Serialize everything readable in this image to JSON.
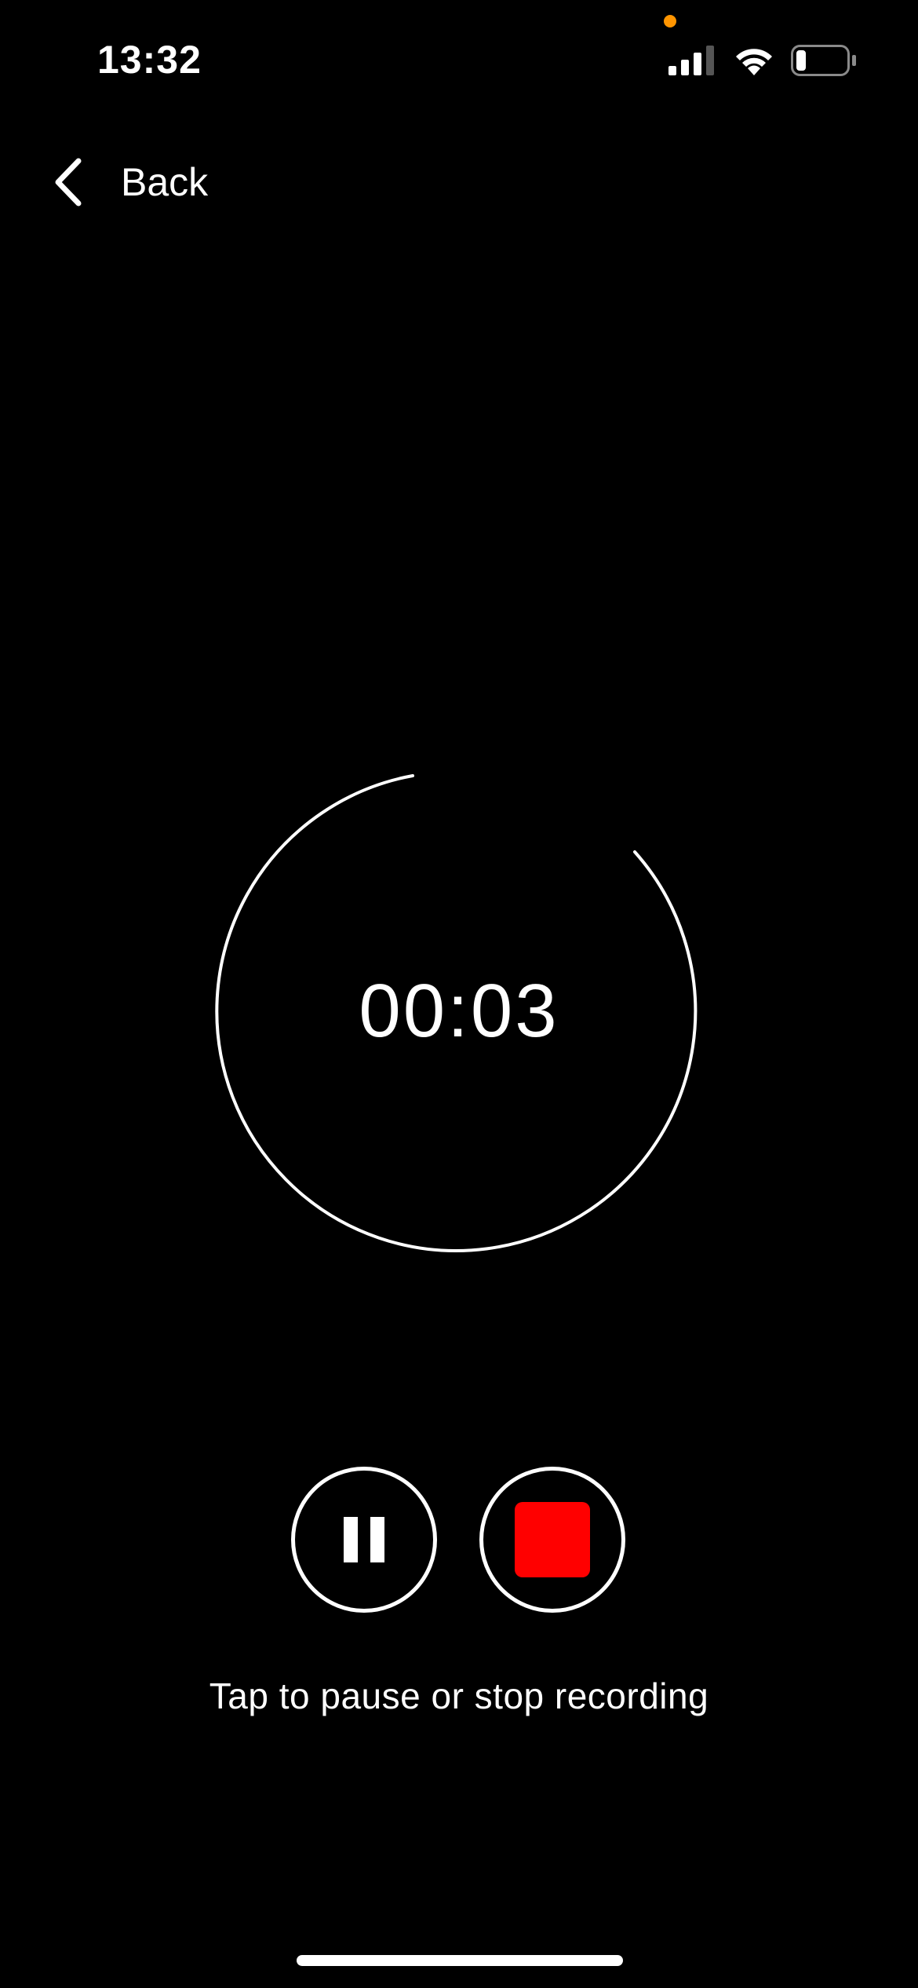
{
  "status_bar": {
    "time": "13:32",
    "icons": [
      "signal-icon",
      "wifi-icon",
      "battery-icon"
    ],
    "mic_indicator_color": "#FF9500",
    "battery_level": 0.2
  },
  "nav": {
    "back_label": "Back",
    "back_icon": "chevron-left-icon"
  },
  "timer": {
    "elapsed": "00:03"
  },
  "controls": {
    "pause_icon": "pause-icon",
    "stop_icon": "stop-icon",
    "stop_color": "#FF0000",
    "hint": "Tap to pause or stop recording"
  },
  "colors": {
    "background": "#000000",
    "foreground": "#FFFFFF"
  }
}
